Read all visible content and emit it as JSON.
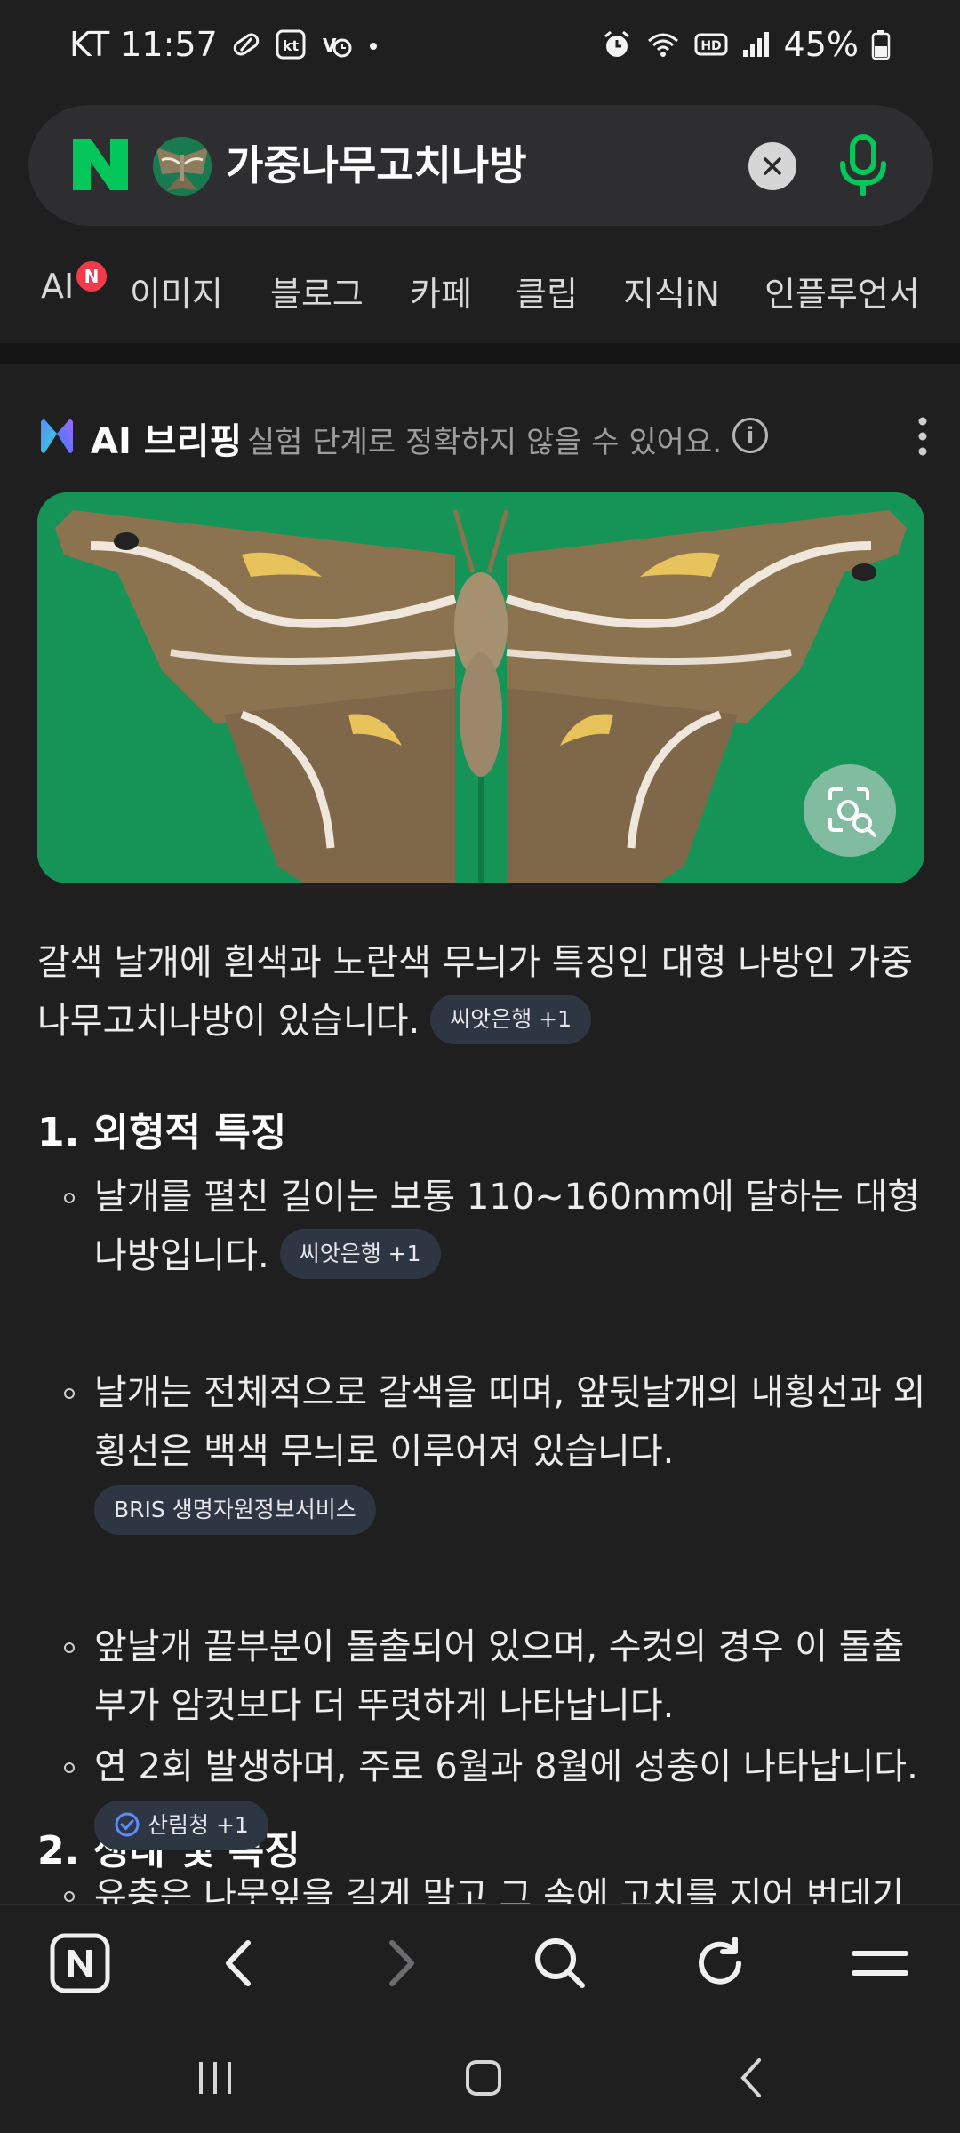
{
  "status_bar": {
    "carrier_time": "KT 11:57",
    "battery": "45%",
    "icons": [
      "pill-icon",
      "kt-icon",
      "volte-icon",
      "dot-icon",
      "alarm-icon",
      "wifi-icon",
      "hd-icon",
      "signal-icon",
      "battery-icon"
    ]
  },
  "search": {
    "query": "가중나무고치나방",
    "clear_icon": "close-icon",
    "mic_icon": "mic-icon",
    "accent": "#03c75a"
  },
  "tabs": [
    {
      "label": "AI",
      "badge": "N"
    },
    {
      "label": "이미지"
    },
    {
      "label": "블로그"
    },
    {
      "label": "카페"
    },
    {
      "label": "클립"
    },
    {
      "label": "지식iN"
    },
    {
      "label": "인플루언서"
    }
  ],
  "briefing": {
    "title": "AI 브리핑",
    "note": "실험 단계로 정확하지 않을 수 있어요."
  },
  "summary": {
    "text": "갈색 날개에 흰색과 노란색 무늬가 특징인 대형 나방인 가중나무고치나방이 있습니다.",
    "source": "씨앗은행 +1"
  },
  "sections": [
    {
      "heading": "1. 외형적 특징",
      "items": [
        {
          "text": "날개를 펼친 길이는 보통 110~160mm에 달하는 대형 나방입니다.",
          "source": "씨앗은행 +1"
        },
        {
          "text": "날개는 전체적으로 갈색을 띠며, 앞뒷날개의 내횡선과 외횡선은 백색 무늬로 이루어져 있습니다.",
          "source": "BRIS 생명자원정보서비스"
        },
        {
          "text": "앞날개 끝부분이 돌출되어 있으며, 수컷의 경우 이 돌출부가 암컷보다 더 뚜렷하게 나타납니다."
        }
      ]
    },
    {
      "heading": "2. 생태 및 특징",
      "items": [
        {
          "text": "연 2회 발생하며, 주로 6월과 8월에 성충이 나타납니다.",
          "source": "산림청 +1"
        },
        {
          "text": "유충은 나뭇잎을 길게 말고 그 속에 고치를 지어 번데기"
        }
      ]
    }
  ]
}
